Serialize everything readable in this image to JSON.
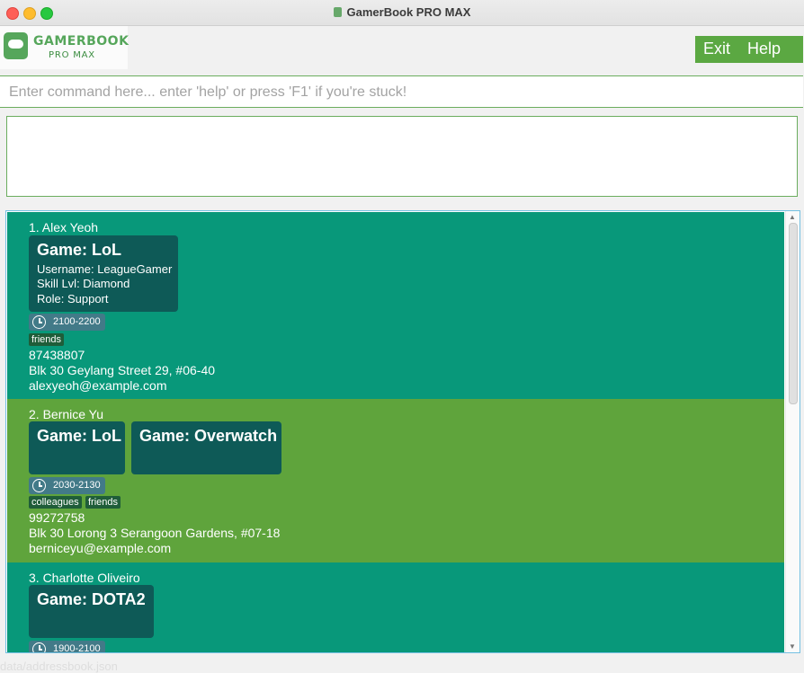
{
  "window": {
    "title": "GamerBook PRO MAX"
  },
  "logo": {
    "line1": "GAMERBOOK",
    "line2": "PRO MAX"
  },
  "menu": {
    "exit_label": "Exit",
    "help_label": "Help",
    "accent": "#5ba842"
  },
  "command": {
    "placeholder": "Enter command here... enter 'help' or press 'F1' if you're stuck!",
    "value": ""
  },
  "result": {
    "text": ""
  },
  "contacts": [
    {
      "name": "1. Alex Yeoh",
      "games": [
        {
          "title": "Game: LoL",
          "username": "Username: LeagueGamer",
          "skill": "Skill Lvl: Diamond",
          "role": "Role: Support"
        }
      ],
      "time": "2100-2200",
      "tags": [
        "friends"
      ],
      "phone": "87438807",
      "address": "Blk 30 Geylang Street 29, #06-40",
      "email": "alexyeoh@example.com"
    },
    {
      "name": "2. Bernice Yu",
      "games": [
        {
          "title": "Game: LoL"
        },
        {
          "title": "Game: Overwatch"
        }
      ],
      "time": "2030-2130",
      "tags": [
        "colleagues",
        "friends"
      ],
      "phone": "99272758",
      "address": "Blk 30 Lorong 3 Serangoon Gardens, #07-18",
      "email": "berniceyu@example.com"
    },
    {
      "name": "3. Charlotte Oliveiro",
      "games": [
        {
          "title": "Game: DOTA2"
        }
      ],
      "time": "1900-2100"
    }
  ],
  "status": {
    "text": "data/addressbook.json"
  },
  "icons": {
    "time": "clock-icon",
    "logo": "controller-icon"
  },
  "colors": {
    "card_teal": "#08987a",
    "card_green": "#5fa43c",
    "game_box": "#0e5a57",
    "tag": "#1f5d39"
  }
}
